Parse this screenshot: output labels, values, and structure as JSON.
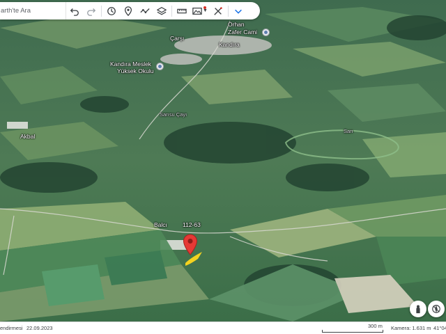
{
  "toolbar": {
    "search_placeholder": "arth'te Ara",
    "icons": [
      "undo-icon",
      "redo-icon",
      "history-icon",
      "place-pin-icon",
      "path-icon",
      "layers-icon",
      "ruler-icon",
      "image-icon",
      "measure-icon",
      "collapse-icon"
    ]
  },
  "map_labels": {
    "orhan": "Orhan",
    "zafer_cami": "Zafer Cami",
    "carsi": "Çarşı",
    "kandira": "Kandıra",
    "school_line1": "Kandıra Meslek",
    "school_line2": "Yüksek Okulu",
    "sarisu_cayi": "Sarısu Çayı",
    "sarisu_right": "Sarı",
    "akbal": "Akbal",
    "balci": "Balcı",
    "road_number": "112-63"
  },
  "status_bar": {
    "left_text": "endirmesi",
    "date": "22.09.2023",
    "scale": "300 m",
    "camera": "Kamera: 1.631 m",
    "coordinate": "41°04"
  },
  "colors": {
    "pin": "#e53935",
    "highlight": "#f4d21f",
    "terrain_dark": "#2f5a3d",
    "terrain_light": "#7fa872"
  }
}
